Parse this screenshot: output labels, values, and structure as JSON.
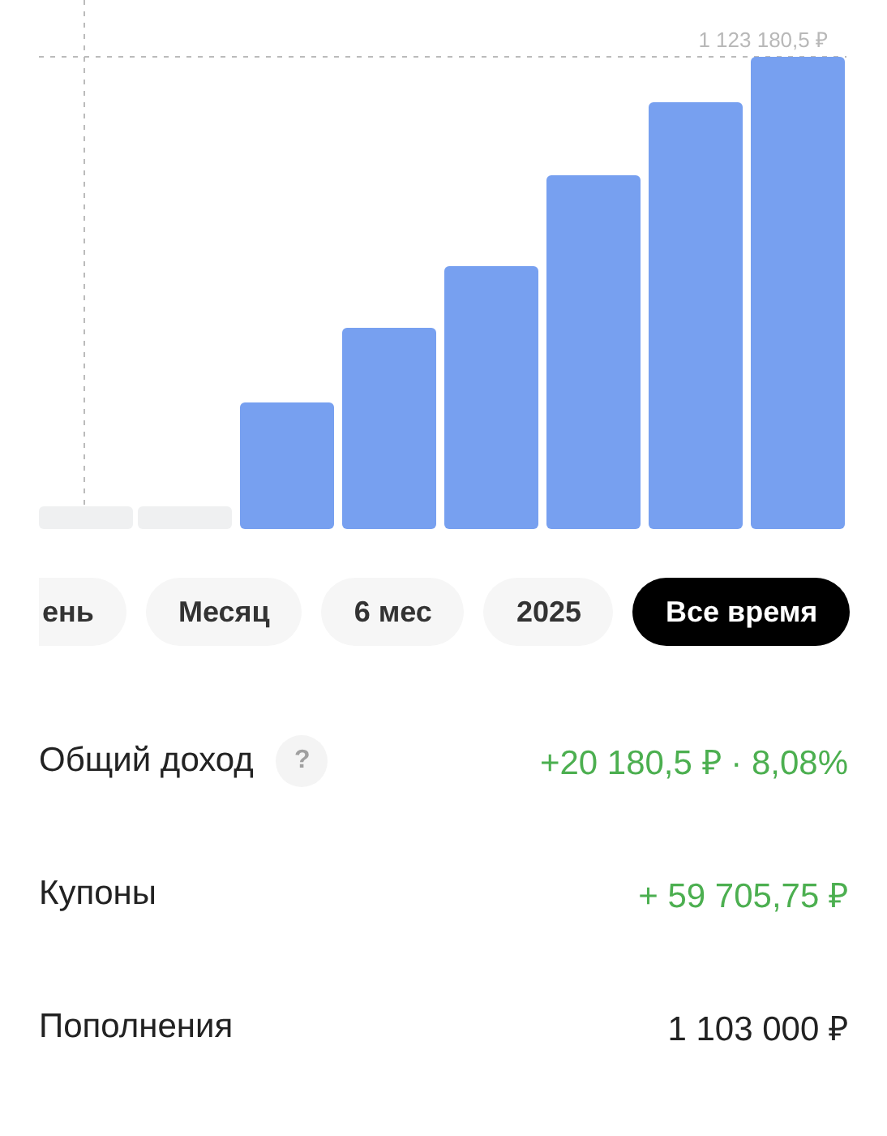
{
  "chart": {
    "max_label": "1 123 180,5 ₽"
  },
  "periods": [
    {
      "label": "ень",
      "selected": false
    },
    {
      "label": "Месяц",
      "selected": false
    },
    {
      "label": "6 мес",
      "selected": false
    },
    {
      "label": "2025",
      "selected": false
    },
    {
      "label": "Все время",
      "selected": true
    }
  ],
  "summary": [
    {
      "label": "Общий доход",
      "help": "?",
      "value": "+20 180,5 ₽ · 8,08%",
      "positive": true
    },
    {
      "label": "Купоны",
      "value": "+ 59 705,75 ₽",
      "positive": true
    },
    {
      "label": "Пополнения",
      "value": "1 103 000 ₽",
      "positive": false
    }
  ]
}
